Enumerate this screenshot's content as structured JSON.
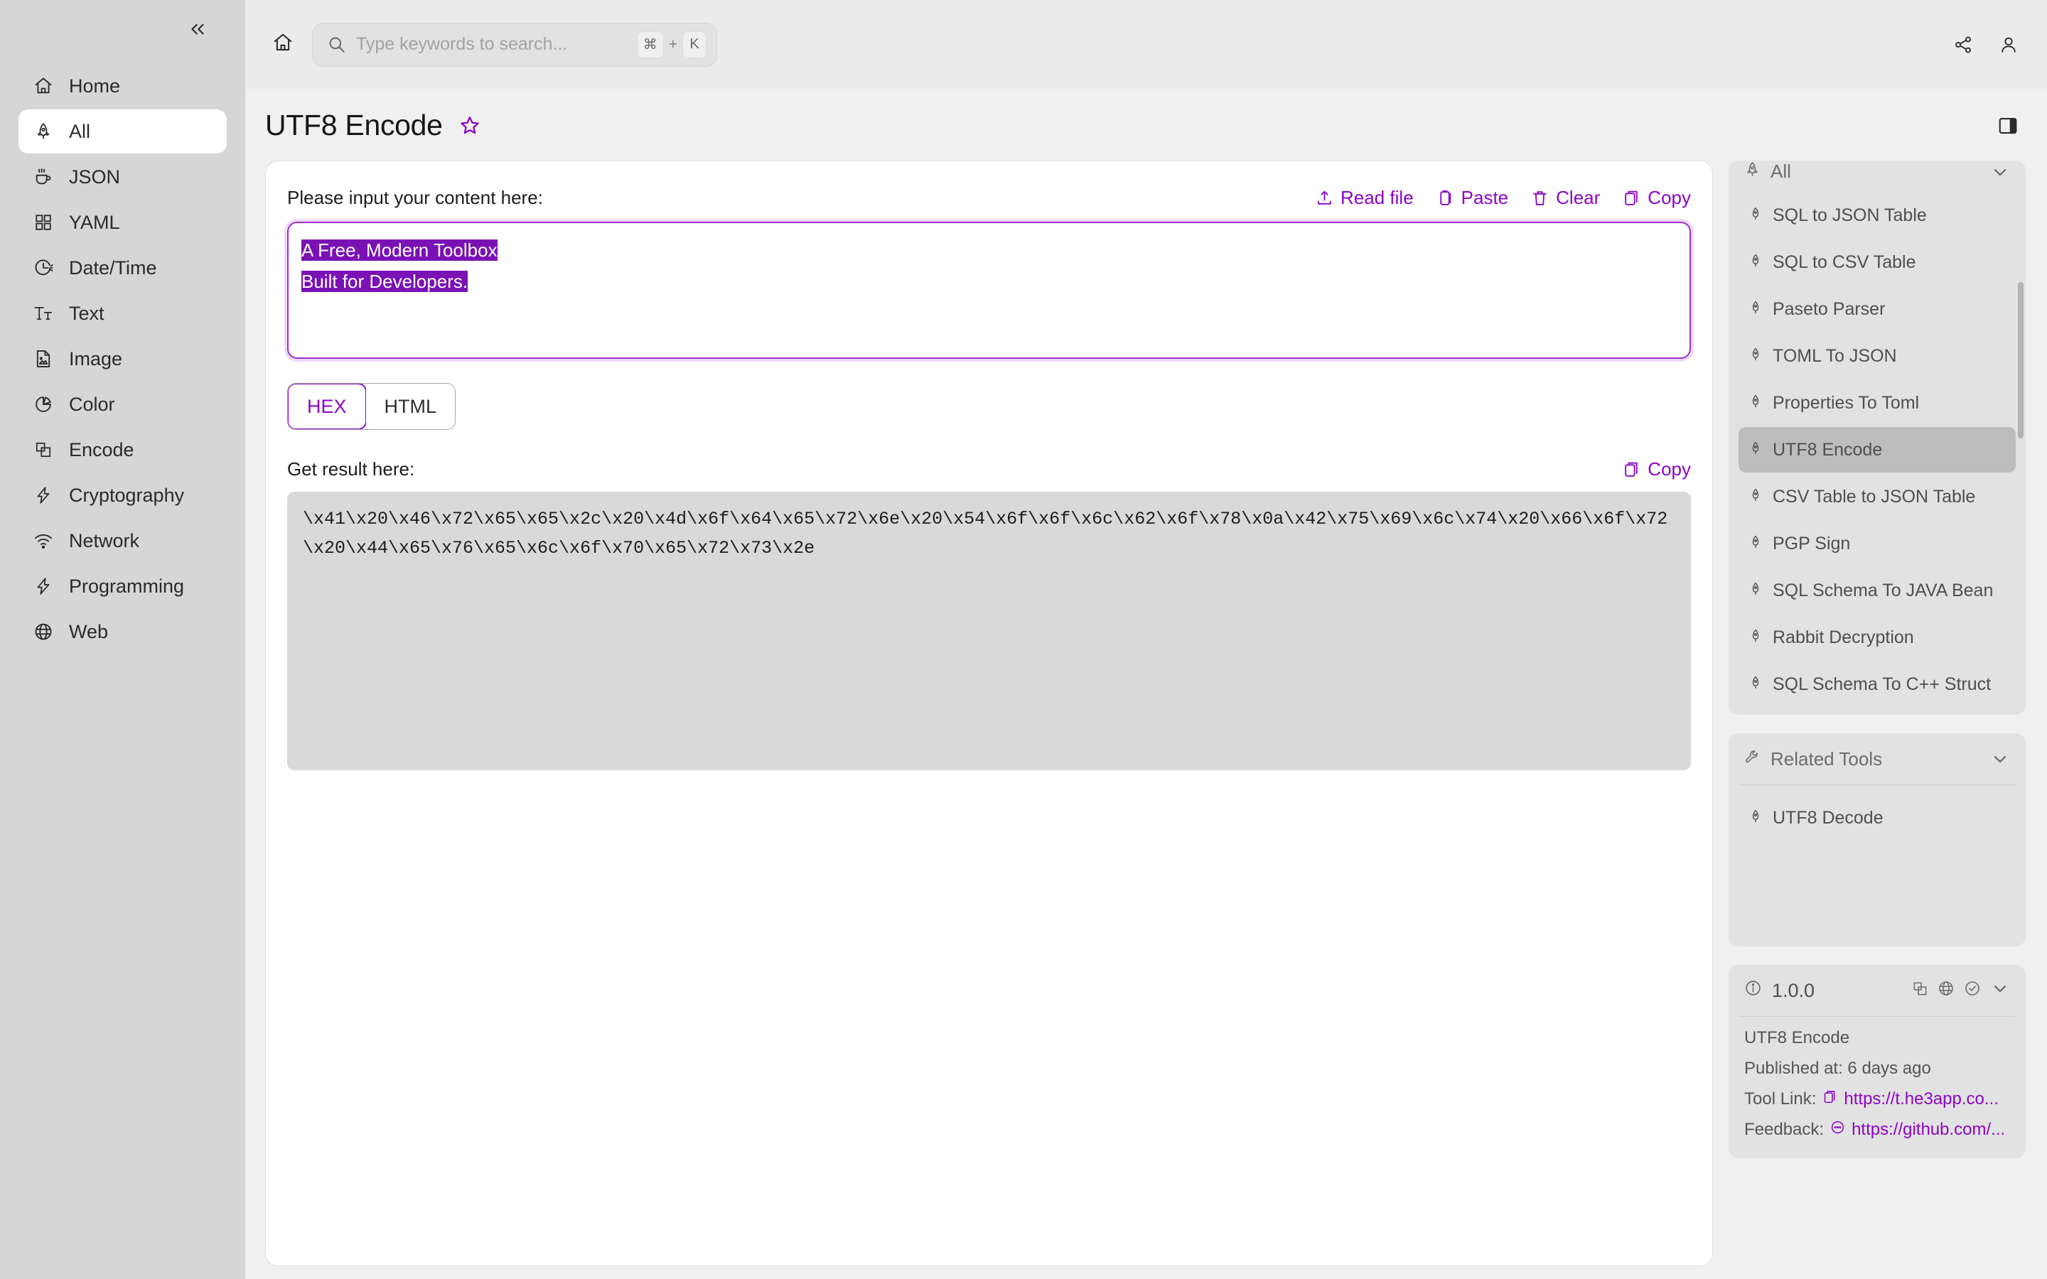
{
  "sidebar": {
    "collapse_icon": "chevrons-left-icon",
    "items": [
      {
        "label": "Home",
        "icon": "home-icon",
        "active": false
      },
      {
        "label": "All",
        "icon": "rocket-icon",
        "active": true
      },
      {
        "label": "JSON",
        "icon": "cup-icon",
        "active": false
      },
      {
        "label": "YAML",
        "icon": "grid-icon",
        "active": false
      },
      {
        "label": "Date/Time",
        "icon": "clock-icon",
        "active": false
      },
      {
        "label": "Text",
        "icon": "text-icon",
        "active": false
      },
      {
        "label": "Image",
        "icon": "image-file-icon",
        "active": false
      },
      {
        "label": "Color",
        "icon": "pie-chart-icon",
        "active": false
      },
      {
        "label": "Encode",
        "icon": "layers-icon",
        "active": false
      },
      {
        "label": "Cryptography",
        "icon": "bolt-icon",
        "active": false
      },
      {
        "label": "Network",
        "icon": "wifi-icon",
        "active": false
      },
      {
        "label": "Programming",
        "icon": "bolt-icon",
        "active": false
      },
      {
        "label": "Web",
        "icon": "globe-icon",
        "active": false
      }
    ]
  },
  "topbar": {
    "home_icon": "home-icon",
    "search": {
      "placeholder": "Type keywords to search...",
      "value": "",
      "shortcut_key1": "⌘",
      "shortcut_plus": "+",
      "shortcut_key2": "K"
    },
    "share_icon": "share-icon",
    "account_icon": "user-icon"
  },
  "page": {
    "title": "UTF8 Encode",
    "favorite_icon": "star-icon",
    "panel_toggle_icon": "side-panel-icon"
  },
  "editor": {
    "input_label": "Please input your content here:",
    "actions": [
      {
        "label": "Read file",
        "icon": "upload-icon"
      },
      {
        "label": "Paste",
        "icon": "clipboard-icon"
      },
      {
        "label": "Clear",
        "icon": "trash-icon"
      },
      {
        "label": "Copy",
        "icon": "copy-icon"
      }
    ],
    "input_line1": "A Free, Modern Toolbox",
    "input_line2": "Built for Developers.",
    "tabs": [
      {
        "label": "HEX",
        "active": true
      },
      {
        "label": "HTML",
        "active": false
      }
    ],
    "result_label": "Get result here:",
    "result_copy_label": "Copy",
    "result_copy_icon": "copy-icon",
    "result_value": "\\x41\\x20\\x46\\x72\\x65\\x65\\x2c\\x20\\x4d\\x6f\\x64\\x65\\x72\\x6e\\x20\\x54\\x6f\\x6f\\x6c\\x62\\x6f\\x78\\x0a\\x42\\x75\\x69\\x6c\\x74\\x20\\x66\\x6f\\x72\\x20\\x44\\x65\\x76\\x65\\x6c\\x6f\\x70\\x65\\x72\\x73\\x2e"
  },
  "right_panel": {
    "tools": {
      "header": "All",
      "header_icon": "rocket-icon",
      "chevron_icon": "chevron-down-icon",
      "items": [
        {
          "label": "SQL to JSON Table",
          "selected": false
        },
        {
          "label": "SQL to CSV Table",
          "selected": false
        },
        {
          "label": "Paseto Parser",
          "selected": false
        },
        {
          "label": "TOML To JSON",
          "selected": false
        },
        {
          "label": "Properties To Toml",
          "selected": false
        },
        {
          "label": "UTF8 Encode",
          "selected": true
        },
        {
          "label": "CSV Table to JSON Table",
          "selected": false
        },
        {
          "label": "PGP Sign",
          "selected": false
        },
        {
          "label": "SQL Schema To JAVA Bean",
          "selected": false
        },
        {
          "label": "Rabbit Decryption",
          "selected": false
        },
        {
          "label": "SQL Schema To C++ Struct",
          "selected": false
        }
      ]
    },
    "related": {
      "header": "Related Tools",
      "header_icon": "wrench-icon",
      "chevron_icon": "chevron-down-icon",
      "items": [
        {
          "label": "UTF8 Decode",
          "selected": false
        }
      ]
    },
    "info": {
      "version": "1.0.0",
      "info_icon": "info-circle-icon",
      "head_icons": [
        "layers-icon",
        "globe-icon",
        "check-circle-icon",
        "chevron-down-icon"
      ],
      "tool_name": "UTF8 Encode",
      "published": "Published at: 6 days ago",
      "tool_link_label": "Tool Link:",
      "tool_link_icon": "copy-icon",
      "tool_link": "https://t.he3app.co...",
      "feedback_label": "Feedback:",
      "feedback_icon": "chat-icon",
      "feedback_link": "https://github.com/..."
    }
  },
  "colors": {
    "accent": "#8c05c4",
    "selection": "#7a11b5",
    "sidebar_bg": "#d6d6d6",
    "panel_bg": "#e2e2e2"
  }
}
